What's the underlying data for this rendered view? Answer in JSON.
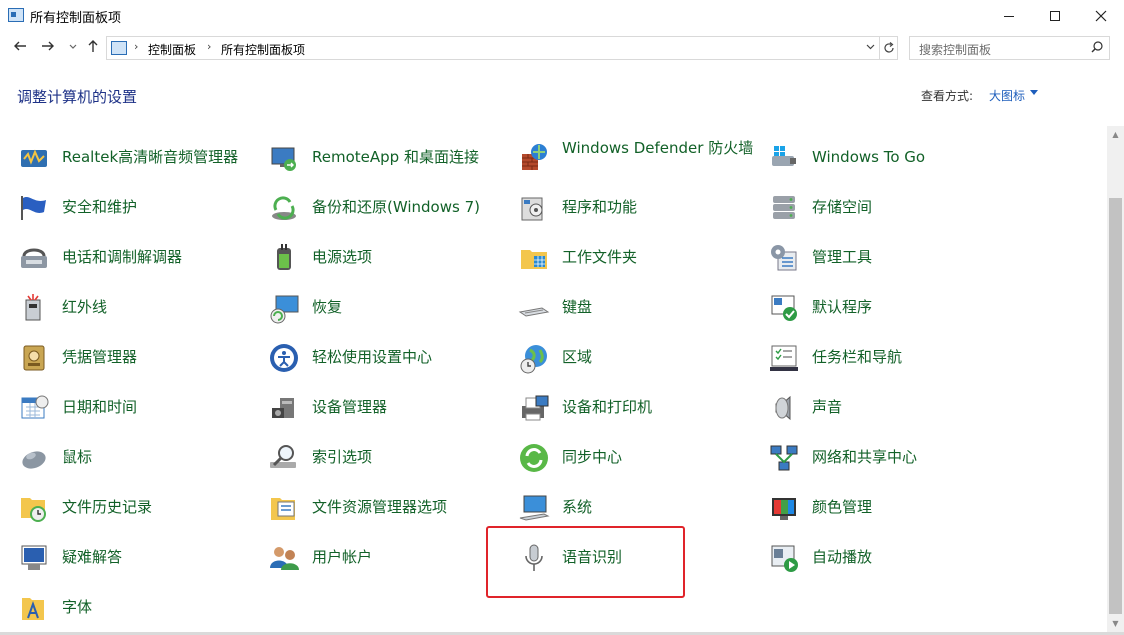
{
  "window": {
    "title": "所有控制面板项"
  },
  "address": {
    "crumbs": [
      "控制面板",
      "所有控制面板项"
    ],
    "search_placeholder": "搜索控制面板"
  },
  "header": {
    "title": "调整计算机的设置",
    "view_label": "查看方式:",
    "view_value": "大图标"
  },
  "items": [
    {
      "label": "Realtek高清晰音频管理器",
      "icon": "realtek-audio-icon"
    },
    {
      "label": "RemoteApp 和桌面连接",
      "icon": "remoteapp-icon"
    },
    {
      "label": "Windows Defender 防火墙",
      "icon": "firewall-icon"
    },
    {
      "label": "Windows To Go",
      "icon": "windows-to-go-icon"
    },
    {
      "label": "安全和维护",
      "icon": "security-flag-icon"
    },
    {
      "label": "备份和还原(Windows 7)",
      "icon": "backup-icon"
    },
    {
      "label": "程序和功能",
      "icon": "programs-icon"
    },
    {
      "label": "存储空间",
      "icon": "storage-icon"
    },
    {
      "label": "电话和调制解调器",
      "icon": "phone-modem-icon"
    },
    {
      "label": "电源选项",
      "icon": "power-icon"
    },
    {
      "label": "工作文件夹",
      "icon": "work-folder-icon"
    },
    {
      "label": "管理工具",
      "icon": "admin-tools-icon"
    },
    {
      "label": "红外线",
      "icon": "infrared-icon"
    },
    {
      "label": "恢复",
      "icon": "recovery-icon"
    },
    {
      "label": "键盘",
      "icon": "keyboard-icon"
    },
    {
      "label": "默认程序",
      "icon": "default-programs-icon"
    },
    {
      "label": "凭据管理器",
      "icon": "credential-icon"
    },
    {
      "label": "轻松使用设置中心",
      "icon": "ease-of-access-icon"
    },
    {
      "label": "区域",
      "icon": "region-icon"
    },
    {
      "label": "任务栏和导航",
      "icon": "taskbar-icon"
    },
    {
      "label": "日期和时间",
      "icon": "datetime-icon"
    },
    {
      "label": "设备管理器",
      "icon": "device-manager-icon"
    },
    {
      "label": "设备和打印机",
      "icon": "printer-icon"
    },
    {
      "label": "声音",
      "icon": "sound-icon"
    },
    {
      "label": "鼠标",
      "icon": "mouse-icon"
    },
    {
      "label": "索引选项",
      "icon": "indexing-icon"
    },
    {
      "label": "同步中心",
      "icon": "sync-icon"
    },
    {
      "label": "网络和共享中心",
      "icon": "network-icon"
    },
    {
      "label": "文件历史记录",
      "icon": "file-history-icon"
    },
    {
      "label": "文件资源管理器选项",
      "icon": "explorer-options-icon"
    },
    {
      "label": "系统",
      "icon": "system-icon"
    },
    {
      "label": "颜色管理",
      "icon": "color-management-icon"
    },
    {
      "label": "疑难解答",
      "icon": "troubleshoot-icon"
    },
    {
      "label": "用户帐户",
      "icon": "user-accounts-icon"
    },
    {
      "label": "语音识别",
      "icon": "microphone-icon"
    },
    {
      "label": "自动播放",
      "icon": "autoplay-icon"
    },
    {
      "label": "字体",
      "icon": "fonts-icon"
    }
  ],
  "colors": {
    "link_green": "#126128",
    "title_blue": "#1e3287",
    "highlight_red": "#e0242a"
  }
}
